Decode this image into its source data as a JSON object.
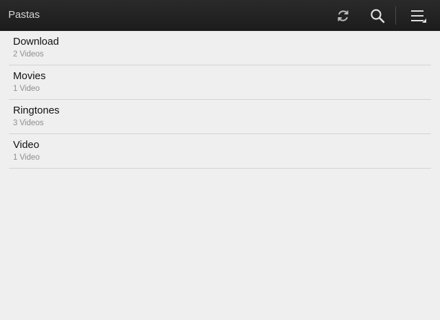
{
  "action_bar": {
    "title": "Pastas",
    "icons": [
      "refresh-icon",
      "search-icon",
      "menu-icon"
    ]
  },
  "folders": [
    {
      "name": "Download",
      "count": "2 Videos"
    },
    {
      "name": "Movies",
      "count": "1 Video"
    },
    {
      "name": "Ringtones",
      "count": "3 Videos"
    },
    {
      "name": "Video",
      "count": "1 Video"
    }
  ],
  "colors": {
    "action_bar_bg": "#222222",
    "list_bg": "#efefef",
    "divider": "#d2d2d2",
    "subtitle": "#8e8e8e"
  }
}
